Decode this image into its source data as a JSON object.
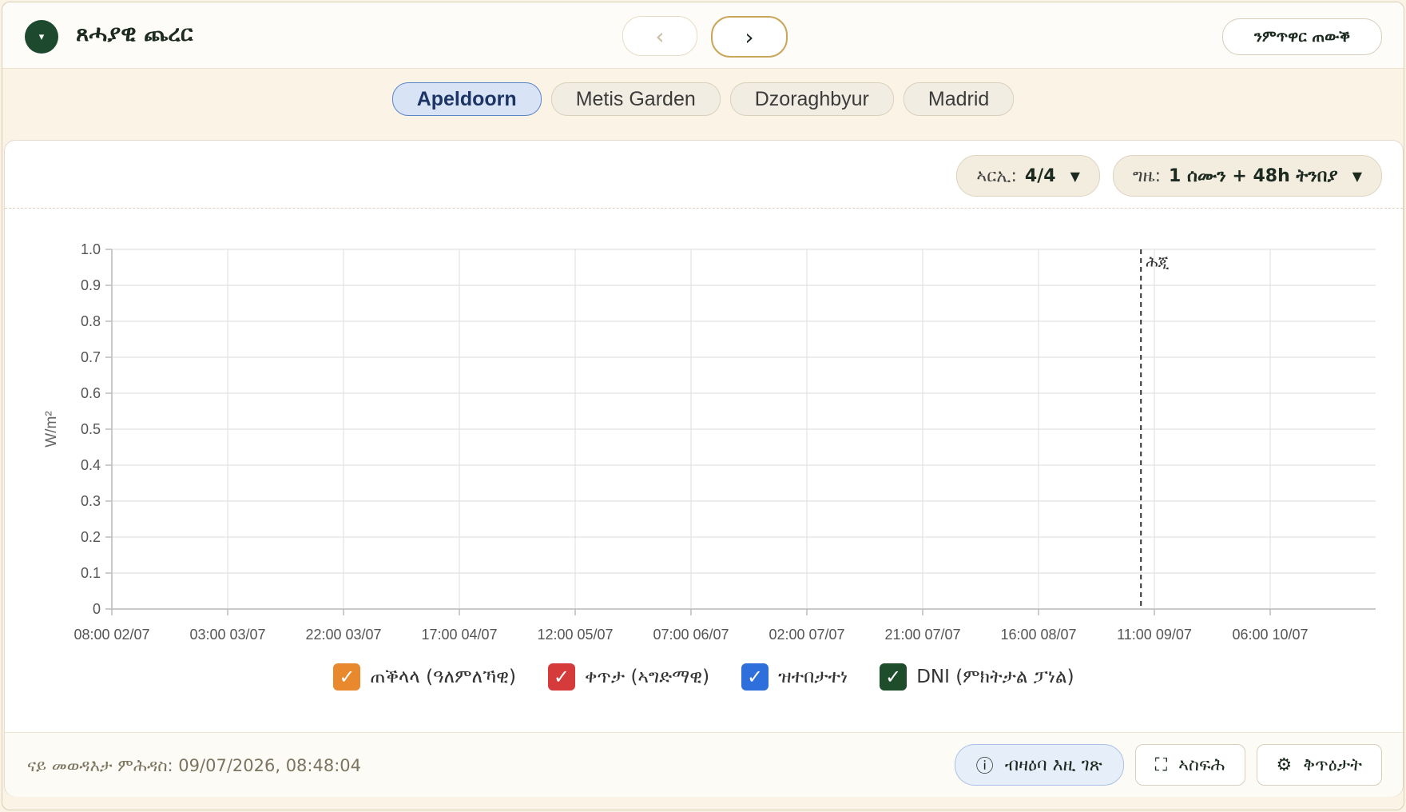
{
  "header": {
    "menu_icon": "▾",
    "title": "ጸሓያዊ ጨረር",
    "prev_icon": "‹",
    "next_icon": "›",
    "action_label": "ንምጥዋር ጠውቕ"
  },
  "tabs": [
    {
      "label": "Apeldoorn",
      "active": true
    },
    {
      "label": "Metis Garden",
      "active": false
    },
    {
      "label": "Dzoraghbyur",
      "active": false
    },
    {
      "label": "Madrid",
      "active": false
    }
  ],
  "controls": {
    "models_key": "ኣርኢ:",
    "models_value": "4/4",
    "time_key": "ግዜ:",
    "time_value": "1 ሰሙን + 48h ትንበያ",
    "caret": "▼"
  },
  "chart_data": {
    "type": "line",
    "ylabel": "W/m²",
    "ylim": [
      0,
      1.0
    ],
    "yticks": [
      "0",
      "0.1",
      "0.2",
      "0.3",
      "0.4",
      "0.5",
      "0.6",
      "0.7",
      "0.8",
      "0.9",
      "1.0"
    ],
    "xticks": [
      "08:00 02/07",
      "03:00 03/07",
      "22:00 03/07",
      "17:00 04/07",
      "12:00 05/07",
      "07:00 06/07",
      "02:00 07/07",
      "21:00 07/07",
      "16:00 08/07",
      "11:00 09/07",
      "06:00 10/07"
    ],
    "now_marker": {
      "label": "ሕጂ",
      "time": "08:48 09/07"
    },
    "grid": true,
    "legend_position": "bottom",
    "series": [
      {
        "name": "ጠቕላላ (ዓለምለኻዊ)",
        "color": "#e8892d",
        "values": []
      },
      {
        "name": "ቀጥታ (ኣግድማዊ)",
        "color": "#d63b3b",
        "values": []
      },
      {
        "name": "ዝተበታተነ",
        "color": "#2f6fdb",
        "values": []
      },
      {
        "name": "DNI (ምክትታል ፓነል)",
        "color": "#1e4d2b",
        "values": []
      }
    ]
  },
  "legend": {
    "check": "✓"
  },
  "footer": {
    "updated": "ናይ መወዳእታ ምሕዳስ: 09/07/2026, 08:48:04",
    "info_icon": "ⓘ",
    "info_label": "ብዛዕባ እዚ ገጽ",
    "fullscreen_icon": "⛶",
    "fullscreen_label": "ኣስፍሕ",
    "settings_icon": "⚙",
    "settings_label": "ቅጥዕታት"
  }
}
